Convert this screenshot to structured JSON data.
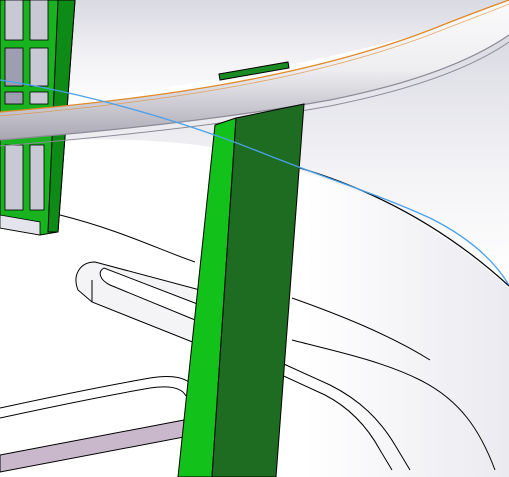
{
  "viewport": {
    "background_color": "#ffffff",
    "sky_gradient_top": "#dcdde4",
    "sky_gradient_bottom": "#ffffff"
  },
  "colors": {
    "green_light": "#12c21b",
    "green_dark": "#1e6b22",
    "green_top": "#1a8a23",
    "edge_black": "#000000",
    "rail_highlight": "#f1f0f3",
    "rail_shadow": "#b9b5bf",
    "rail_edge_orange": "#e08a2a",
    "sketch_blue": "#4aa0ea",
    "slot_purple": "#c9b8cc",
    "window_glass": "#d6d6e2"
  },
  "scene": {
    "objects": [
      "vertical-green-post",
      "window-frame-grid",
      "curved-rail",
      "blue-sketch-line",
      "rounded-slot-cutout",
      "purple-rail-strip",
      "base-plate-curves"
    ]
  }
}
